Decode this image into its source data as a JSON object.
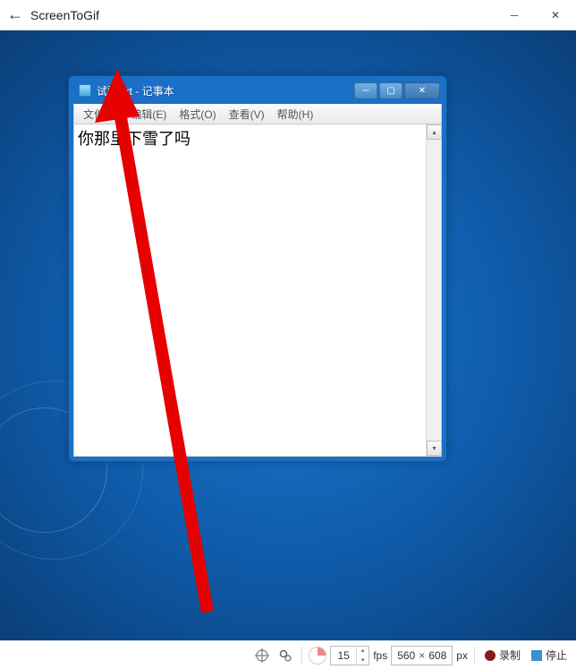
{
  "titlebar": {
    "app_name": "ScreenToGif"
  },
  "notepad": {
    "title": "试验.txt - 记事本",
    "menus": {
      "file": "文件(F)",
      "edit": "编辑(E)",
      "format": "格式(O)",
      "view": "查看(V)",
      "help": "帮助(H)"
    },
    "content": "你那里下雪了吗"
  },
  "toolbar": {
    "fps_value": "15",
    "fps_label": "fps",
    "width": "560",
    "height": "608",
    "dim_sep": "×",
    "px_label": "px",
    "record_label": "录制",
    "stop_label": "停止"
  }
}
